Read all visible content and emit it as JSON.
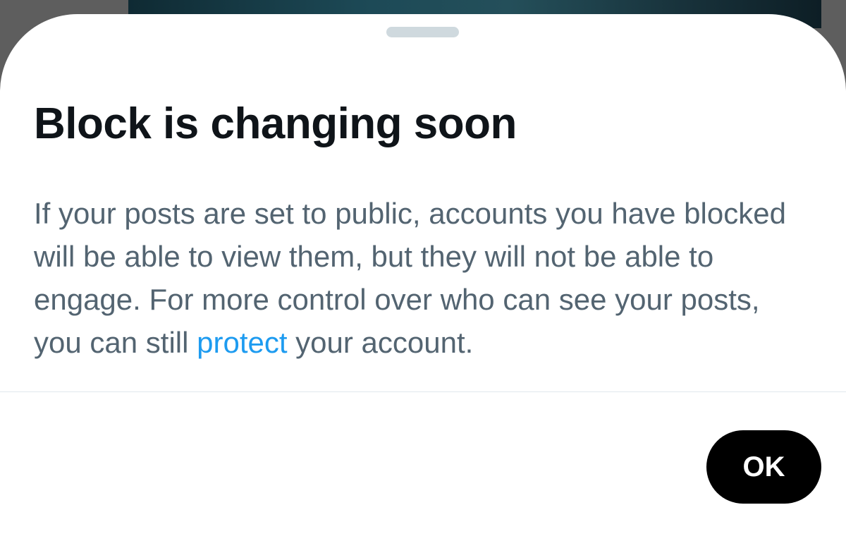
{
  "sheet": {
    "title": "Block is changing soon",
    "body_before_link": "If your posts are set to public, accounts you have blocked will be able to view them, but they will not be able to engage. For more control over who can see your posts, you can still ",
    "link_text": "protect",
    "body_after_link": " your account.",
    "ok_label": "OK"
  },
  "colors": {
    "title": "#0f1419",
    "body": "#536471",
    "link": "#1d9bf0",
    "button_bg": "#000000",
    "button_text": "#ffffff"
  }
}
